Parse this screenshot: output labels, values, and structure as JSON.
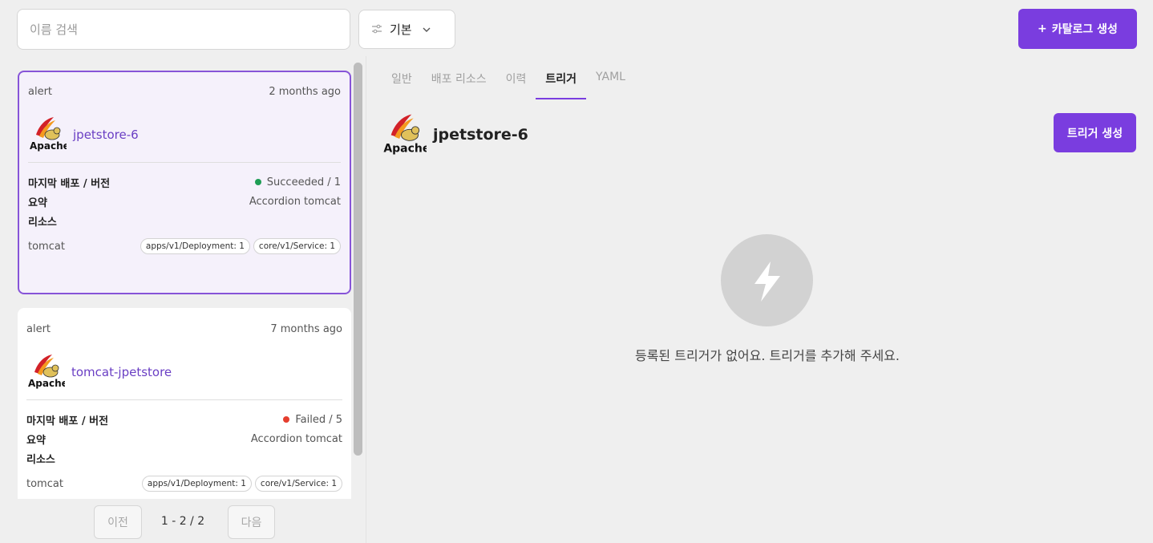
{
  "search": {
    "placeholder": "이름 검색"
  },
  "sort": {
    "label": "기본"
  },
  "header": {
    "create_label": "카탈로그 생성"
  },
  "catalogs": [
    {
      "type": "alert",
      "time": "2 months ago",
      "name": "jpetstore-6",
      "deploy_label": "마지막 배포 / 버전",
      "deploy_value": "Succeeded / 1",
      "status_color": "#1f9d55",
      "summary_label": "요약",
      "summary_value": "Accordion tomcat",
      "resources_label": "리소스",
      "resource_name": "tomcat",
      "chips": [
        "apps/v1/Deployment: 1",
        "core/v1/Service: 1"
      ]
    },
    {
      "type": "alert",
      "time": "7 months ago",
      "name": "tomcat-jpetstore",
      "deploy_label": "마지막 배포 / 버전",
      "deploy_value": "Failed / 5",
      "status_color": "#e53e2e",
      "summary_label": "요약",
      "summary_value": "Accordion tomcat",
      "resources_label": "리소스",
      "resource_name": "tomcat",
      "chips": [
        "apps/v1/Deployment: 1",
        "core/v1/Service: 1"
      ]
    }
  ],
  "pager": {
    "prev": "이전",
    "info": "1 - 2 / 2",
    "next": "다음"
  },
  "tabs": [
    {
      "label": "일반"
    },
    {
      "label": "배포 리소스"
    },
    {
      "label": "이력"
    },
    {
      "label": "트리거",
      "active": true
    },
    {
      "label": "YAML"
    }
  ],
  "detail": {
    "title": "jpetstore-6",
    "trigger_button": "트리거 생성",
    "empty_message": "등록된 트리거가 없어요. 트리거를 추가해 주세요."
  },
  "colors": {
    "accent": "#7a3ddf",
    "selected_bg": "#f5f1fb",
    "success": "#1f9d55",
    "failed": "#e53e2e"
  }
}
